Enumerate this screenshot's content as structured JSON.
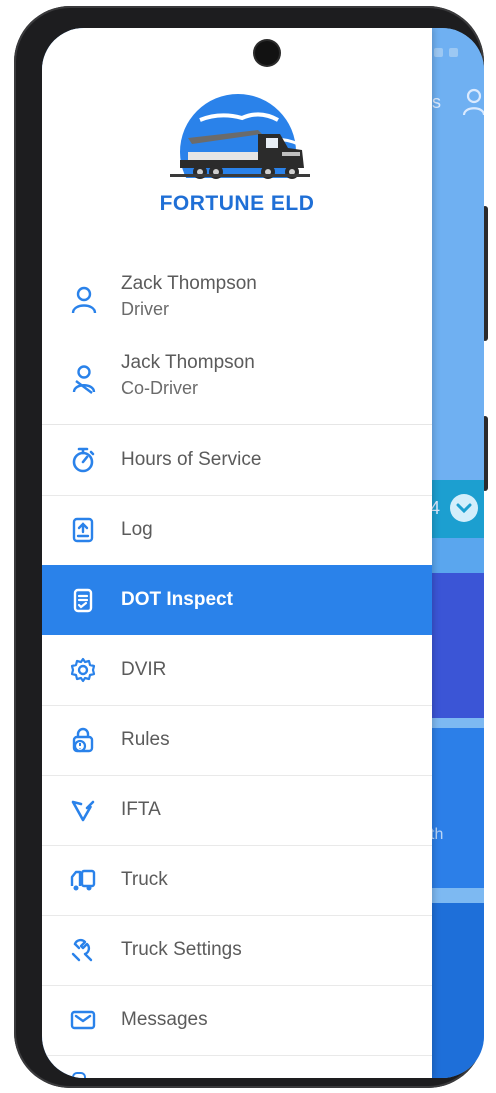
{
  "app": {
    "brand": "FORTUNE ELD",
    "accent_color": "#2a82ea"
  },
  "users": [
    {
      "name": "Zack Thompson",
      "role": "Driver",
      "icon": "user-icon"
    },
    {
      "name": "Jack Thompson",
      "role": "Co-Driver",
      "icon": "user-remove-icon"
    }
  ],
  "menu": [
    {
      "label": "Hours of Service",
      "icon": "stopwatch-icon",
      "active": false
    },
    {
      "label": "Log",
      "icon": "log-upload-icon",
      "active": false
    },
    {
      "label": "DOT Inspect",
      "icon": "clipboard-icon",
      "active": true
    },
    {
      "label": "DVIR",
      "icon": "gear-icon",
      "active": false
    },
    {
      "label": "Rules",
      "icon": "rules-icon",
      "active": false
    },
    {
      "label": "IFTA",
      "icon": "ifta-icon",
      "active": false
    },
    {
      "label": "Truck",
      "icon": "truck-icon",
      "active": false
    },
    {
      "label": "Truck Settings",
      "icon": "wrench-icon",
      "active": false
    },
    {
      "label": "Messages",
      "icon": "envelope-icon",
      "active": false
    }
  ],
  "background": {
    "partial_text_top": "is",
    "partial_text_mid": "4",
    "partial_text_lower": "th"
  }
}
